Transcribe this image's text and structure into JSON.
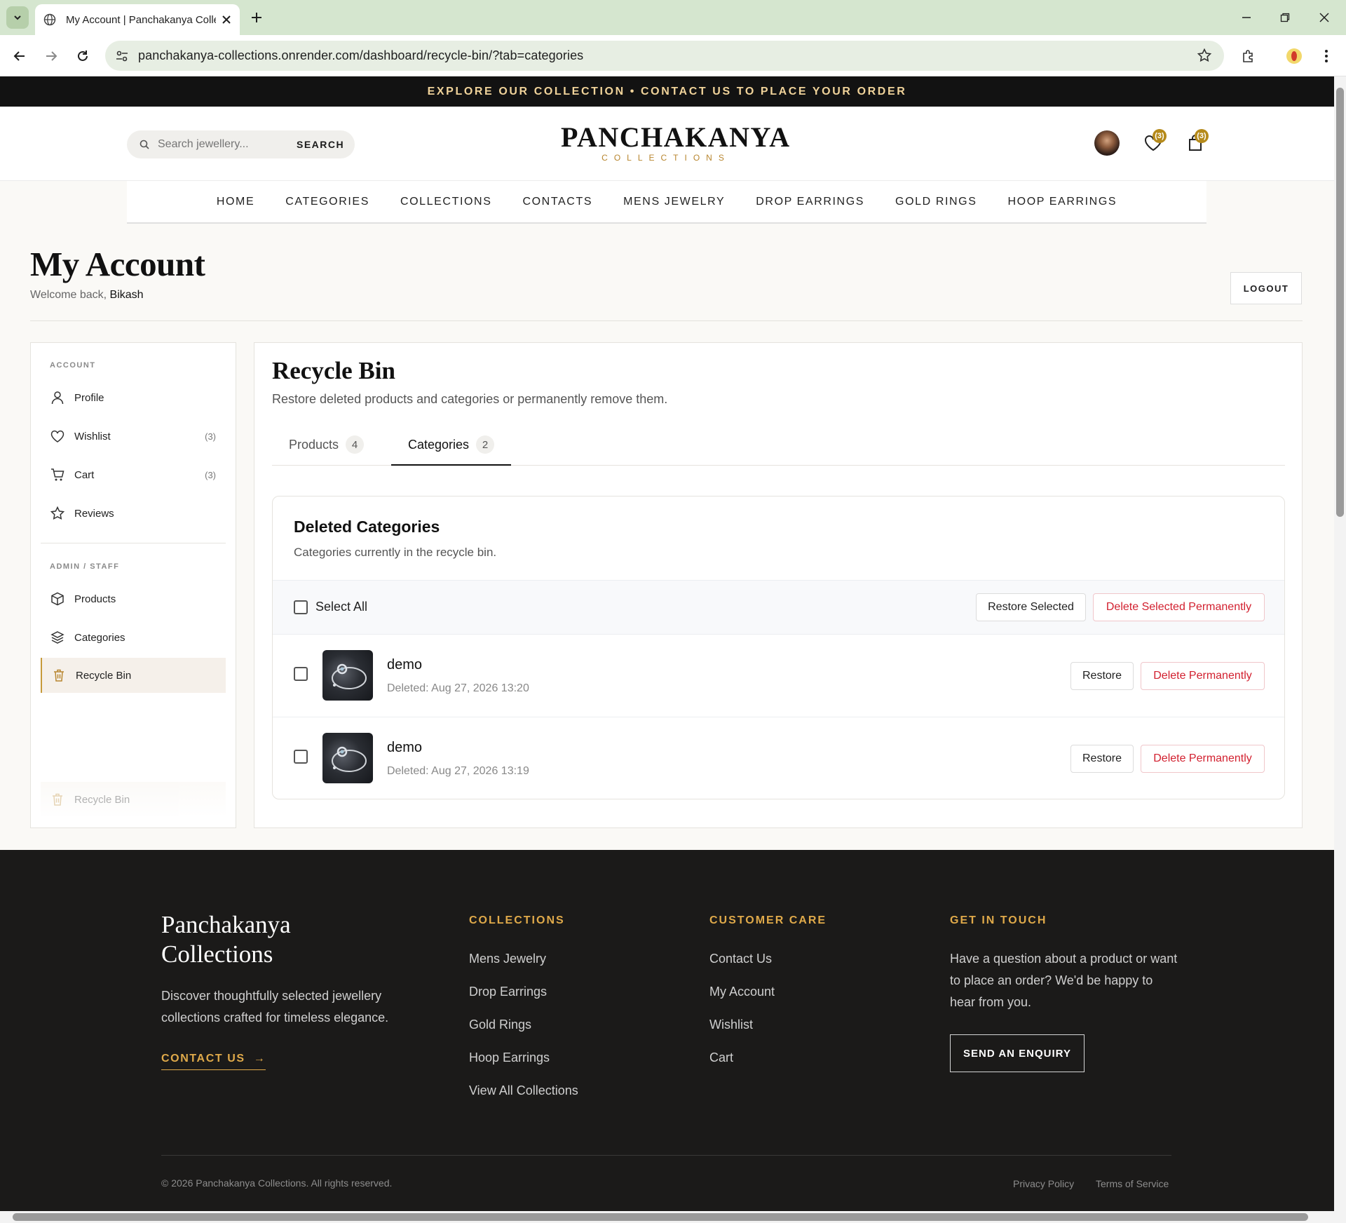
{
  "browser": {
    "tab_title": "My Account | Panchakanya Collections",
    "url": "panchakanya-collections.onrender.com/dashboard/recycle-bin/?tab=categories"
  },
  "announcement": "EXPLORE OUR COLLECTION • CONTACT US TO PLACE YOUR ORDER",
  "header": {
    "search_placeholder": "Search jewellery...",
    "search_button": "SEARCH",
    "logo_main": "PANCHAKANYA",
    "logo_sub": "COLLECTIONS",
    "wishlist_badge": "(3)",
    "cart_badge": "(3)"
  },
  "nav": [
    "HOME",
    "CATEGORIES",
    "COLLECTIONS",
    "CONTACTS",
    "MENS JEWELRY",
    "DROP EARRINGS",
    "GOLD RINGS",
    "HOOP EARRINGS"
  ],
  "account": {
    "title": "My Account",
    "welcome_prefix": "Welcome back,",
    "user_name": "Bikash",
    "logout": "LOGOUT"
  },
  "sidebar": {
    "account_heading": "ACCOUNT",
    "admin_heading": "ADMIN / STAFF",
    "items": [
      {
        "label": "Profile",
        "count": ""
      },
      {
        "label": "Wishlist",
        "count": "(3)"
      },
      {
        "label": "Cart",
        "count": "(3)"
      },
      {
        "label": "Reviews",
        "count": ""
      },
      {
        "label": "Products",
        "count": ""
      },
      {
        "label": "Categories",
        "count": ""
      },
      {
        "label": "Recycle Bin",
        "count": ""
      }
    ],
    "ghost_label": "Recycle Bin"
  },
  "recycle_bin": {
    "title": "Recycle Bin",
    "subtitle": "Restore deleted products and categories or permanently remove them.",
    "tabs": [
      {
        "label": "Products",
        "count": "4"
      },
      {
        "label": "Categories",
        "count": "2"
      }
    ],
    "card_title": "Deleted Categories",
    "card_subtitle": "Categories currently in the recycle bin.",
    "select_all": "Select All",
    "restore_selected": "Restore Selected",
    "delete_selected": "Delete Selected Permanently",
    "restore": "Restore",
    "delete_permanently": "Delete Permanently",
    "rows": [
      {
        "name": "demo",
        "deleted": "Deleted: Aug 27, 2026 13:20"
      },
      {
        "name": "demo",
        "deleted": "Deleted: Aug 27, 2026 13:19"
      }
    ]
  },
  "footer": {
    "brand_line1": "Panchakanya",
    "brand_line2": "Collections",
    "description": "Discover thoughtfully selected jewellery collections crafted for timeless elegance.",
    "contact_link": "CONTACT US",
    "collections_heading": "COLLECTIONS",
    "collections": [
      "Mens Jewelry",
      "Drop Earrings",
      "Gold Rings",
      "Hoop Earrings",
      "View All Collections"
    ],
    "care_heading": "CUSTOMER CARE",
    "care": [
      "Contact Us",
      "My Account",
      "Wishlist",
      "Cart"
    ],
    "touch_heading": "GET IN TOUCH",
    "touch_text": "Have a question about a product or want to place an order? We'd be happy to hear from you.",
    "enquiry_button": "SEND AN ENQUIRY",
    "copyright": "© 2026 Panchakanya Collections. All rights reserved.",
    "privacy": "Privacy Policy",
    "terms": "Terms of Service"
  }
}
